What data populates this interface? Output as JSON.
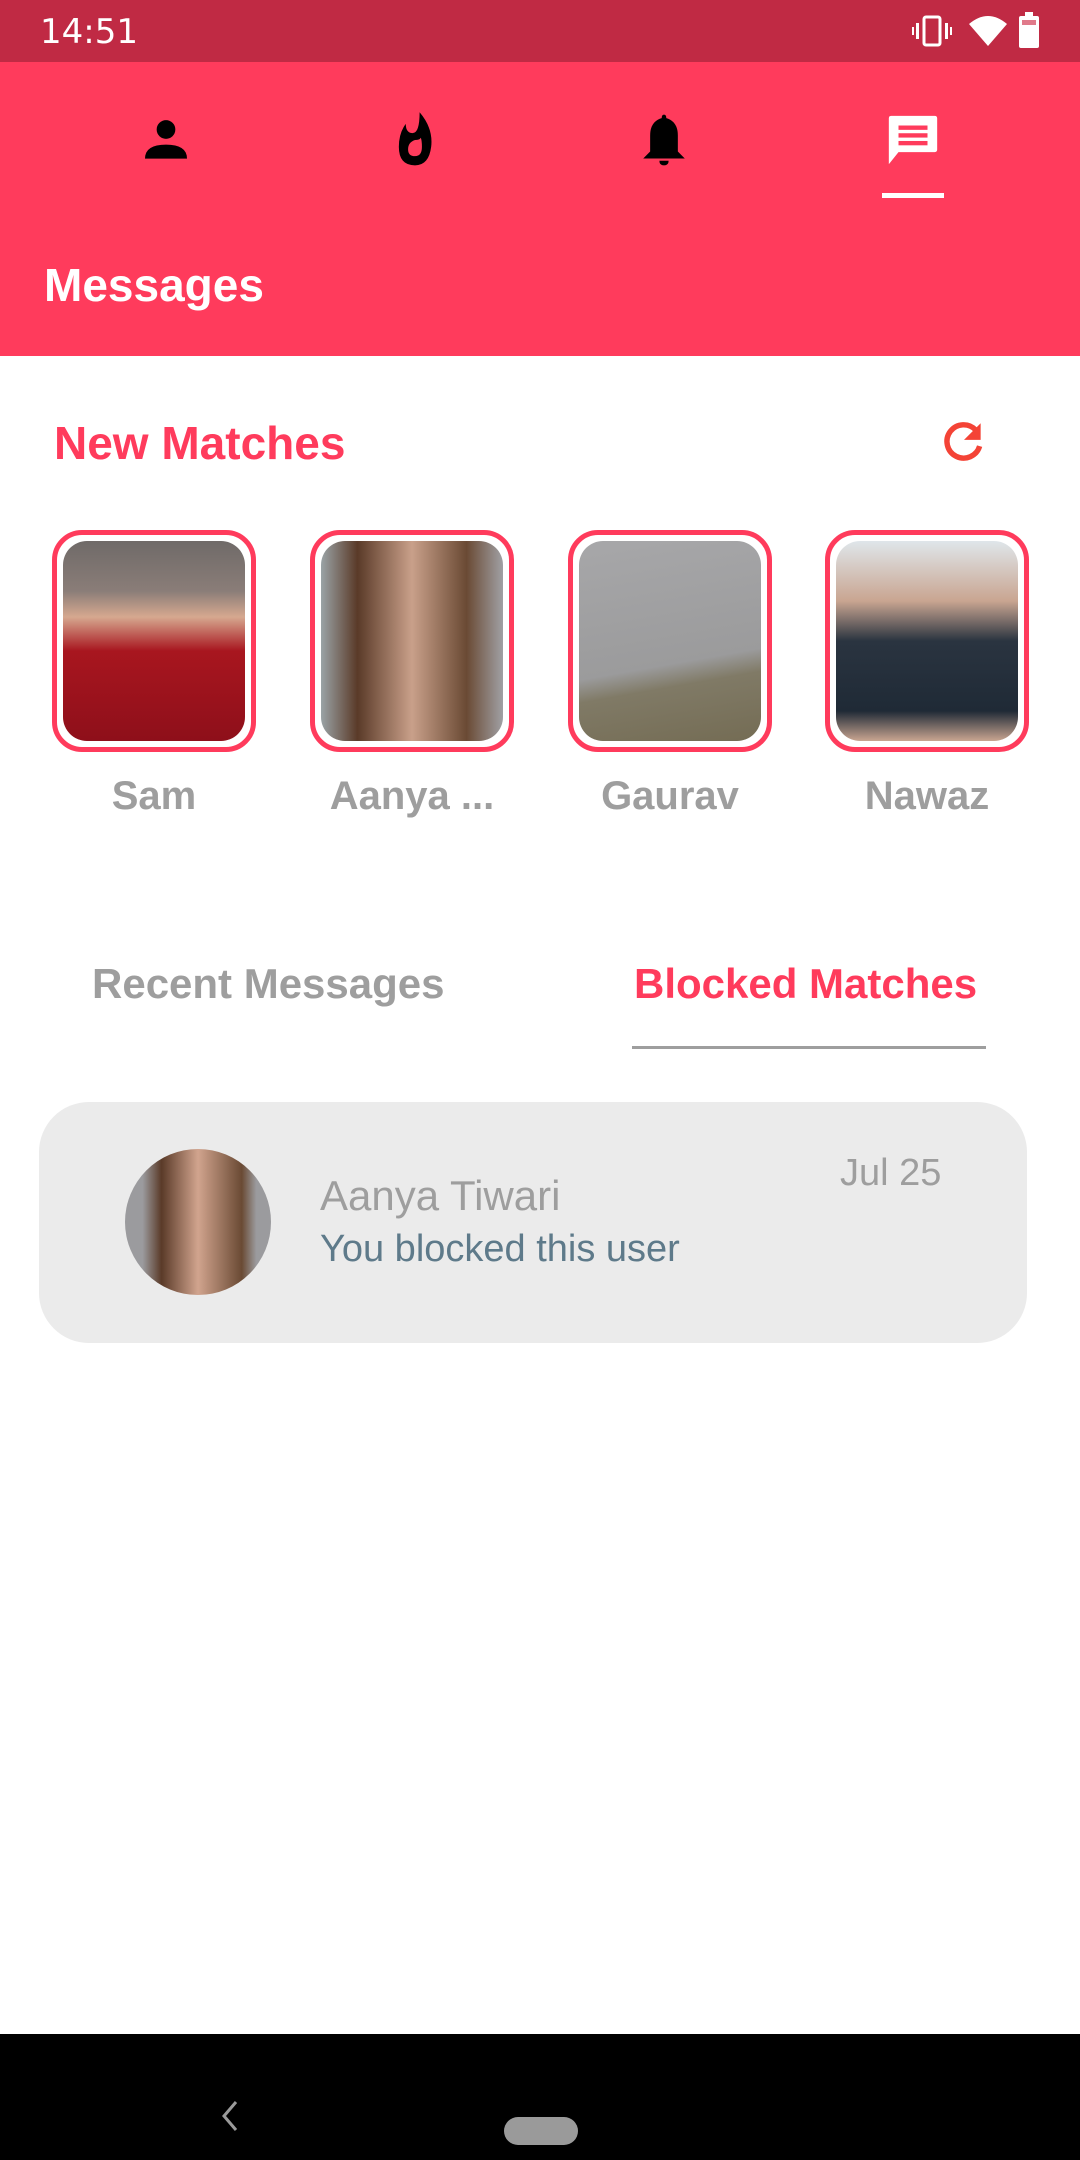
{
  "status_bar": {
    "time": "14:51",
    "icons": [
      "vibrate-icon",
      "wifi-icon",
      "battery-icon"
    ]
  },
  "top_nav": {
    "items": [
      {
        "icon": "person-icon",
        "label": "Profile",
        "active": false
      },
      {
        "icon": "flame-icon",
        "label": "Discover",
        "active": false
      },
      {
        "icon": "bell-icon",
        "label": "Notifications",
        "active": false
      },
      {
        "icon": "chat-icon",
        "label": "Messages",
        "active": true
      }
    ]
  },
  "header": {
    "title": "Messages"
  },
  "new_matches": {
    "title": "New Matches",
    "refresh_icon": "refresh-icon",
    "items": [
      {
        "name": "Sam"
      },
      {
        "name": "Aanya ..."
      },
      {
        "name": "Gaurav"
      },
      {
        "name": "Nawaz"
      }
    ]
  },
  "tabs": [
    {
      "label": "Recent Messages",
      "active": false
    },
    {
      "label": "Blocked Matches",
      "active": true
    }
  ],
  "blocked_list": [
    {
      "name": "Aanya Tiwari",
      "status": "You blocked this user",
      "date": "Jul 25"
    }
  ],
  "colors": {
    "brand": "#ff3b5c",
    "status_bar": "#c02a44",
    "card_bg": "#ebebeb",
    "muted_text": "#9e9e9e",
    "status_text": "#5e7a8a"
  }
}
